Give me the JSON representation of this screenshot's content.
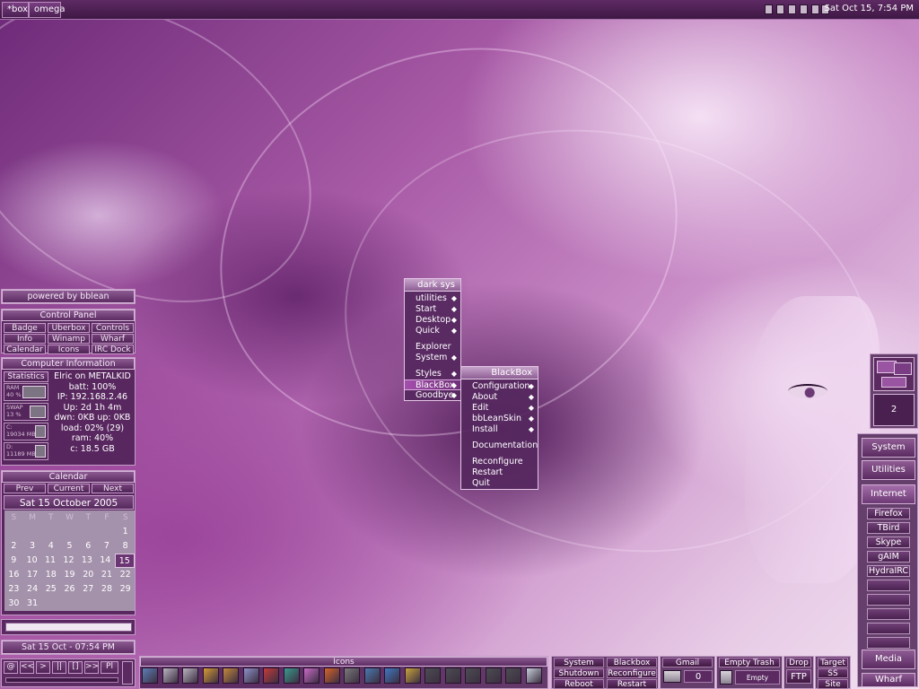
{
  "topbar": {
    "workspace_tab": "*box",
    "window_tab": "omega",
    "clock": "Sat Oct 15, 7:54 PM",
    "tray_icons": [
      "network-icon",
      "volume-icon",
      "messenger-icon",
      "hardware-icon",
      "monitor-icon",
      "battery-icon"
    ]
  },
  "powered": "powered by bblean",
  "control_panel": {
    "title": "Control Panel",
    "buttons": [
      "Badge",
      "Uberbox",
      "Controls",
      "Info",
      "Winamp",
      "Wharf",
      "Calendar",
      "Icons",
      "IRC Dock"
    ]
  },
  "computer_info": {
    "title": "Computer Information",
    "statistics_label": "Statistics",
    "meters": [
      {
        "label": "RAM",
        "value": "40 %",
        "fill": 0.4
      },
      {
        "label": "SWAP",
        "value": "13 %",
        "fill": 0.13
      },
      {
        "label": "C:",
        "value": "19034 MB",
        "fill": 0.6
      },
      {
        "label": "D:",
        "value": "11189 MB",
        "fill": 0.4
      }
    ],
    "lines": [
      "Elric on METALKID",
      "batt: 100%",
      "IP: 192.168.2.46",
      "Up: 2d 1h 4m",
      "dwn: 0KB up: 0KB",
      "load: 02% (29)",
      "ram: 40%",
      "c: 18.5 GB"
    ]
  },
  "calendar": {
    "title": "Calendar",
    "nav": [
      "Prev",
      "Current",
      "Next"
    ],
    "date_heading": "Sat 15 October  2005",
    "weekdays": [
      "S",
      "M",
      "T",
      "W",
      "T",
      "F",
      "S"
    ],
    "weeks": [
      [
        "",
        "",
        "",
        "",
        "",
        "",
        "1"
      ],
      [
        "2",
        "3",
        "4",
        "5",
        "6",
        "7",
        "8"
      ],
      [
        "9",
        "10",
        "11",
        "12",
        "13",
        "14",
        "15"
      ],
      [
        "16",
        "17",
        "18",
        "19",
        "20",
        "21",
        "22"
      ],
      [
        "23",
        "24",
        "25",
        "26",
        "27",
        "28",
        "29"
      ],
      [
        "30",
        "31",
        "",
        "",
        "",
        "",
        ""
      ]
    ],
    "today": "15"
  },
  "datetime_label": "Sat 15 Oct - 07:54 PM",
  "player_controls": [
    "@",
    "<<",
    ">",
    "||",
    "[]",
    ">>",
    "Pl"
  ],
  "menus": {
    "main": {
      "title": "dark sys",
      "items": [
        {
          "label": "utilities",
          "arrow": true
        },
        {
          "label": "Start",
          "arrow": true
        },
        {
          "label": "Desktop",
          "arrow": true
        },
        {
          "label": "Quick",
          "arrow": true
        },
        {
          "sep": true
        },
        {
          "label": "Explorer",
          "arrow": false
        },
        {
          "label": "System",
          "arrow": true
        },
        {
          "sep": true
        },
        {
          "label": "Styles",
          "arrow": true
        },
        {
          "label": "BlackBox",
          "arrow": true,
          "highlight": true
        },
        {
          "label": "Goodbye",
          "arrow": true
        }
      ]
    },
    "sub": {
      "title": "BlackBox",
      "items": [
        {
          "label": "Configuration",
          "arrow": true
        },
        {
          "label": "About",
          "arrow": true
        },
        {
          "label": "Edit",
          "arrow": true
        },
        {
          "label": "bbLeanSkin",
          "arrow": true
        },
        {
          "label": "Install",
          "arrow": true
        },
        {
          "sep": true
        },
        {
          "label": "Documentation",
          "arrow": false
        },
        {
          "sep": true
        },
        {
          "label": "Reconfigure",
          "arrow": false
        },
        {
          "label": "Restart",
          "arrow": false
        },
        {
          "label": "Quit",
          "arrow": false
        }
      ]
    }
  },
  "pager": {
    "current": "2"
  },
  "dock": {
    "system": "System",
    "utilities": "Utilities",
    "internet": "Internet",
    "internet_items": [
      "Firefox",
      "TBird",
      "Skype",
      "gAIM",
      "HydraIRC",
      "",
      "",
      "",
      "",
      ""
    ],
    "media": "Media",
    "wharf": "Wharf"
  },
  "bottom": {
    "icons_title": "Icons",
    "icon_names": [
      "disk-icon",
      "drive-icon",
      "printer-icon",
      "hand-icon",
      "tools-icon",
      "document-icon",
      "shield-icon",
      "screen-icon",
      "palette-icon",
      "firefox-icon",
      "knife-icon",
      "terminal-icon",
      "globe-icon",
      "paint-icon",
      "cube-icon",
      "cube-icon",
      "cube-icon",
      "cube-icon",
      "cube-icon",
      "cd-icon"
    ],
    "system_buttons": [
      "System",
      "Shutdown",
      "Reboot",
      "Blackbox",
      "Reconfigure",
      "Restart"
    ],
    "gmail": {
      "label": "Gmail",
      "count": "0"
    },
    "trash": {
      "label": "Empty Trash",
      "status": "Empty"
    },
    "drop": {
      "label": "Drop",
      "ftp": "FTP"
    },
    "target": {
      "label": "Target",
      "ss": "SS",
      "site": "Site"
    }
  },
  "colors": {
    "accent": "#8b5a91",
    "border": "#c49cc7",
    "panel_bg": "#481e50"
  }
}
